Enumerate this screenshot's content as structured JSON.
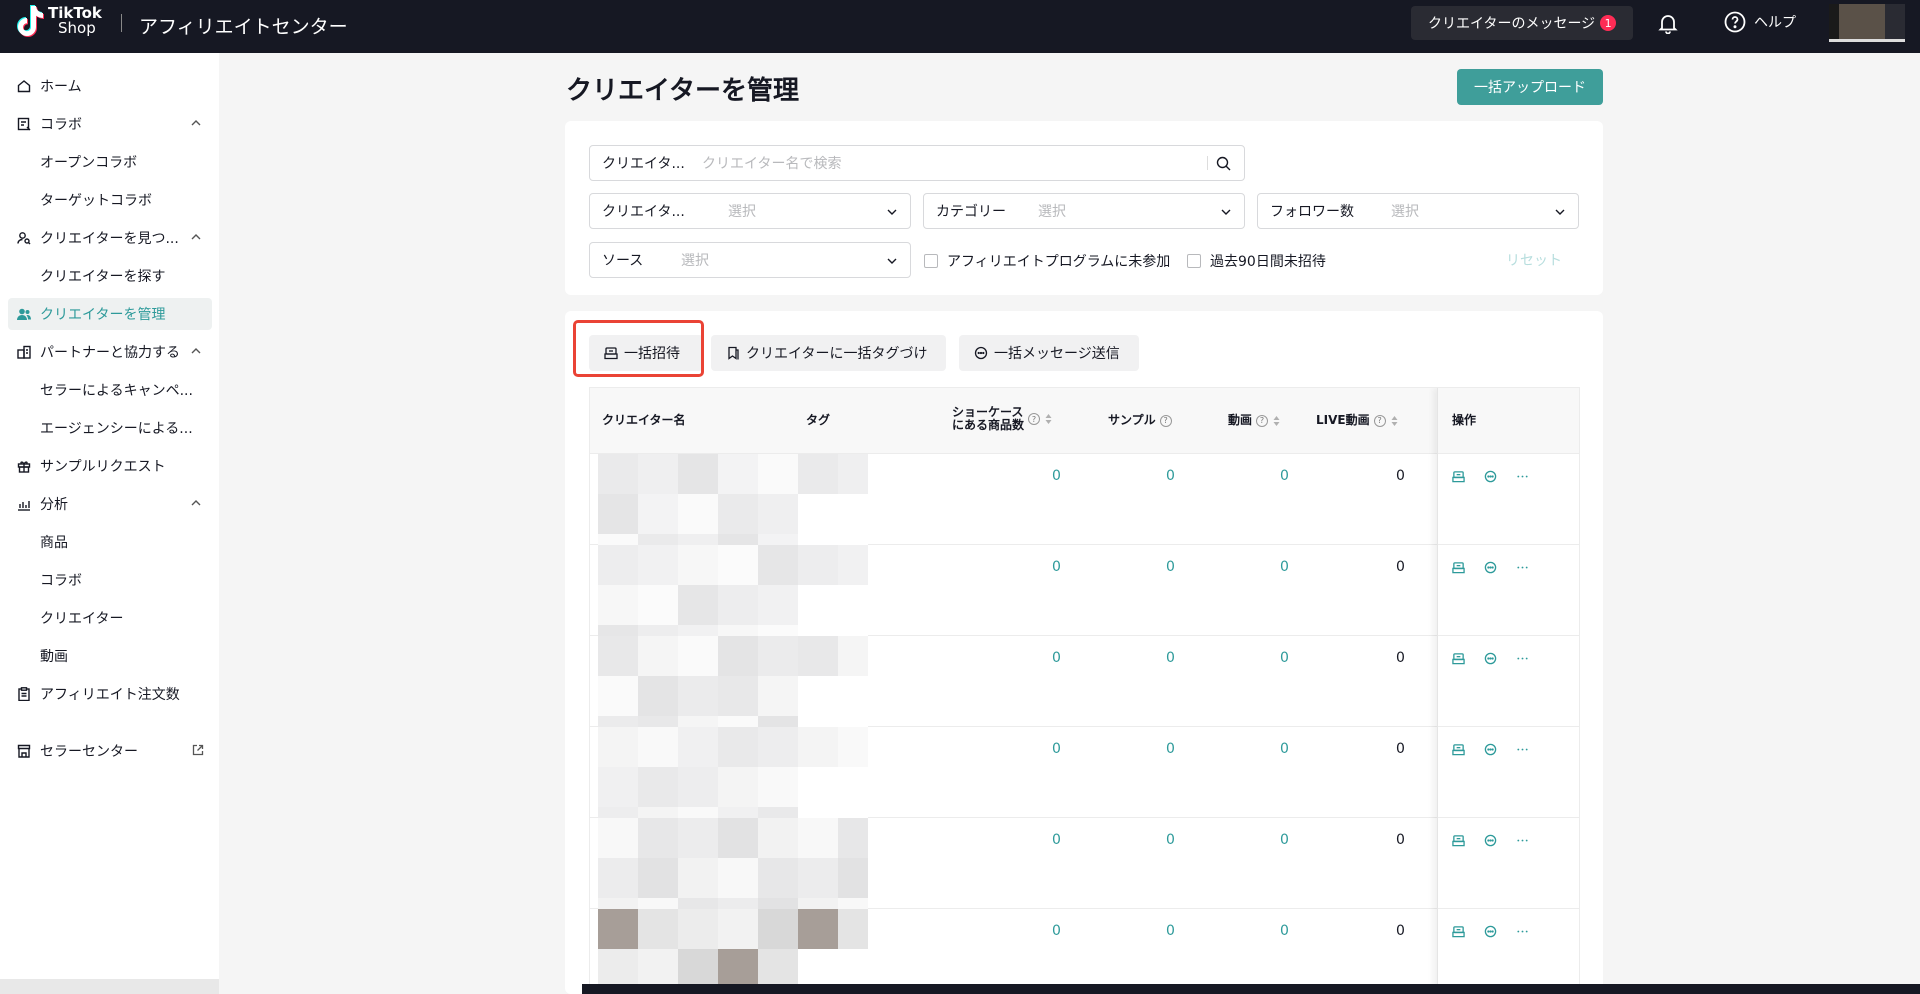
{
  "topbar": {
    "logo_line1": "TikTok",
    "logo_line2": "Shop",
    "app_title": "アフィリエイトセンター",
    "messages_label": "クリエイターのメッセージ",
    "messages_badge": "1",
    "help_label": "ヘルプ"
  },
  "sidebar": {
    "items": [
      {
        "label": "ホーム",
        "icon": "home-icon"
      },
      {
        "label": "コラボ",
        "icon": "collab-icon"
      },
      {
        "label": "オープンコラボ"
      },
      {
        "label": "ターゲットコラボ"
      },
      {
        "label": "クリエイターを見つ...",
        "icon": "find-creator-icon"
      },
      {
        "label": "クリエイターを探す"
      },
      {
        "label": "クリエイターを管理",
        "icon": "users-icon"
      },
      {
        "label": "パートナーと協力する",
        "icon": "partner-icon"
      },
      {
        "label": "セラーによるキャンペ..."
      },
      {
        "label": "エージェンシーによる..."
      },
      {
        "label": "サンプルリクエスト",
        "icon": "gift-icon"
      },
      {
        "label": "分析",
        "icon": "chart-icon"
      },
      {
        "label": "商品"
      },
      {
        "label": "コラボ"
      },
      {
        "label": "クリエイター"
      },
      {
        "label": "動画"
      },
      {
        "label": "アフィリエイト注文数",
        "icon": "clipboard-icon"
      },
      {
        "label": "セラーセンター",
        "icon": "store-icon"
      }
    ]
  },
  "main": {
    "title": "クリエイターを管理",
    "bulk_upload": "一括アップロード",
    "filters": {
      "search_label": "クリエイタ...",
      "search_placeholder": "クリエイター名で検索",
      "creator_label": "クリエイタ...",
      "creator_placeholder": "選択",
      "category_label": "カテゴリー",
      "category_placeholder": "選択",
      "followers_label": "フォロワー数",
      "followers_placeholder": "選択",
      "source_label": "ソース",
      "source_placeholder": "選択",
      "check_not_joined": "アフィリエイトプログラムに未参加",
      "check_not_invited": "過去90日間未招待",
      "reset": "リセット"
    },
    "toolbar": {
      "bulk_invite": "一括招待",
      "bulk_tag": "クリエイターに一括タグづけ",
      "bulk_message": "一括メッセージ送信"
    },
    "table": {
      "headers": {
        "name": "クリエイター名",
        "tag": "タグ",
        "showcase_line1": "ショーケース",
        "showcase_line2": "にある商品数",
        "sample": "サンプル",
        "video": "動画",
        "live": "LIVE動画",
        "action": "操作"
      },
      "rows": [
        {
          "showcase": "0",
          "sample": "0",
          "video": "0",
          "live": "0"
        },
        {
          "showcase": "0",
          "sample": "0",
          "video": "0",
          "live": "0"
        },
        {
          "showcase": "0",
          "sample": "0",
          "video": "0",
          "live": "0"
        },
        {
          "showcase": "0",
          "sample": "0",
          "video": "0",
          "live": "0"
        },
        {
          "showcase": "0",
          "sample": "0",
          "video": "0",
          "live": "0"
        },
        {
          "showcase": "0",
          "sample": "0",
          "video": "0",
          "live": "0"
        }
      ]
    }
  },
  "colors": {
    "accent": "#2d9a9a",
    "button_teal": "#3f9e9a",
    "topbar": "#161823",
    "highlight": "#ea4335"
  }
}
